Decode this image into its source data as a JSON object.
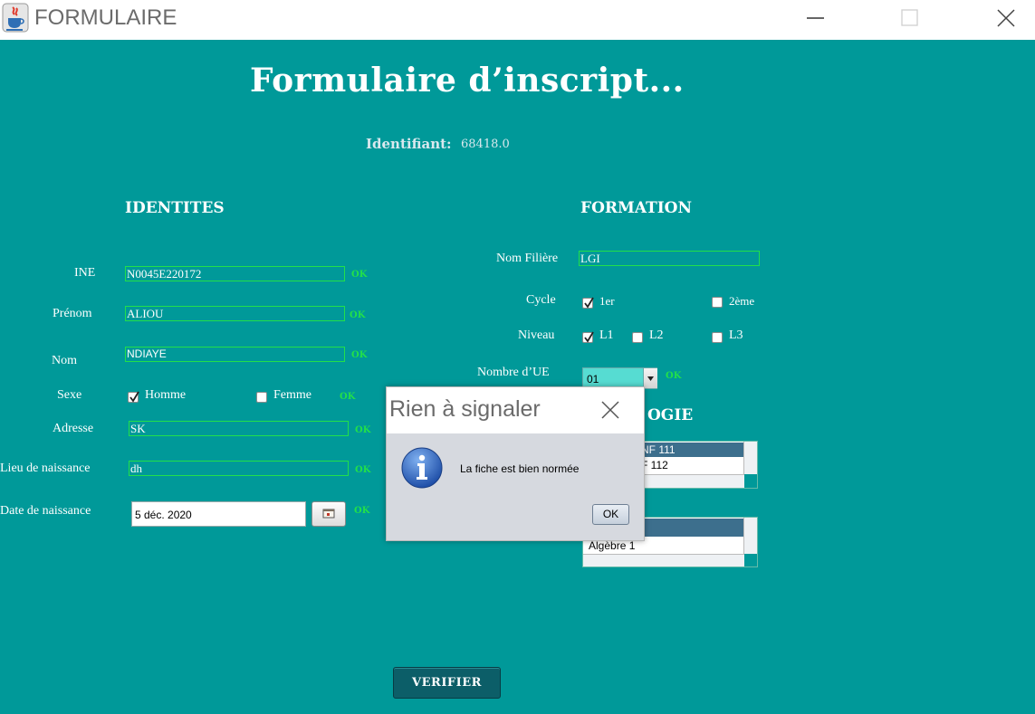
{
  "window": {
    "title": "FORMULAIRE",
    "app_icon": "java-cup-icon"
  },
  "form": {
    "heading": "Formulaire d’inscript...",
    "identifiant_label": "Identifiant:",
    "identifiant_value": "68418.0"
  },
  "identites": {
    "heading": "IDENTITES",
    "ine": {
      "label": "INE",
      "value": "N0045E220172",
      "status": "OK"
    },
    "prenom": {
      "label": "Prénom",
      "value": "ALIOU",
      "status": "OK"
    },
    "nom": {
      "label": "Nom",
      "value": "NDIAYE",
      "status": "OK"
    },
    "sexe": {
      "label": "Sexe",
      "homme": "Homme",
      "femme": "Femme",
      "homme_checked": true,
      "femme_checked": false,
      "status": "OK"
    },
    "adresse": {
      "label": "Adresse",
      "value": "SK",
      "status": "OK"
    },
    "lieu": {
      "label": "Lieu de naissance",
      "value": "dh",
      "status": "OK"
    },
    "date": {
      "label": "Date de naissance",
      "value": "5 déc. 2020",
      "status": "OK"
    }
  },
  "formation": {
    "heading": "FORMATION",
    "filiere": {
      "label": "Nom Filière",
      "value": "LGI"
    },
    "cycle": {
      "label": "Cycle",
      "opt1": "1er",
      "opt2": "2ème",
      "opt1_checked": true,
      "opt2_checked": false
    },
    "niveau": {
      "label": "Niveau",
      "l1": "L1",
      "l2": "L2",
      "l3": "L3",
      "l1_checked": true
    },
    "nb_ue": {
      "label": "Nombre d’UE",
      "value": "01",
      "status": "OK"
    },
    "section2_heading_visible": "OGIE",
    "list1": {
      "row1": "ue INF 111",
      "row2": "F 112"
    },
    "list2": {
      "row2": "Algèbre 1"
    }
  },
  "verify_button": "VERIFIER",
  "dialog": {
    "title": "Rien à signaler",
    "message": "La fiche est bien normée",
    "ok": "OK",
    "icon": "info-icon"
  },
  "colors": {
    "background": "#009999",
    "field_border": "#22e04a",
    "ok_text": "#22e04a",
    "selected_row": "#3d6f8d",
    "button": "#0c5e68"
  }
}
